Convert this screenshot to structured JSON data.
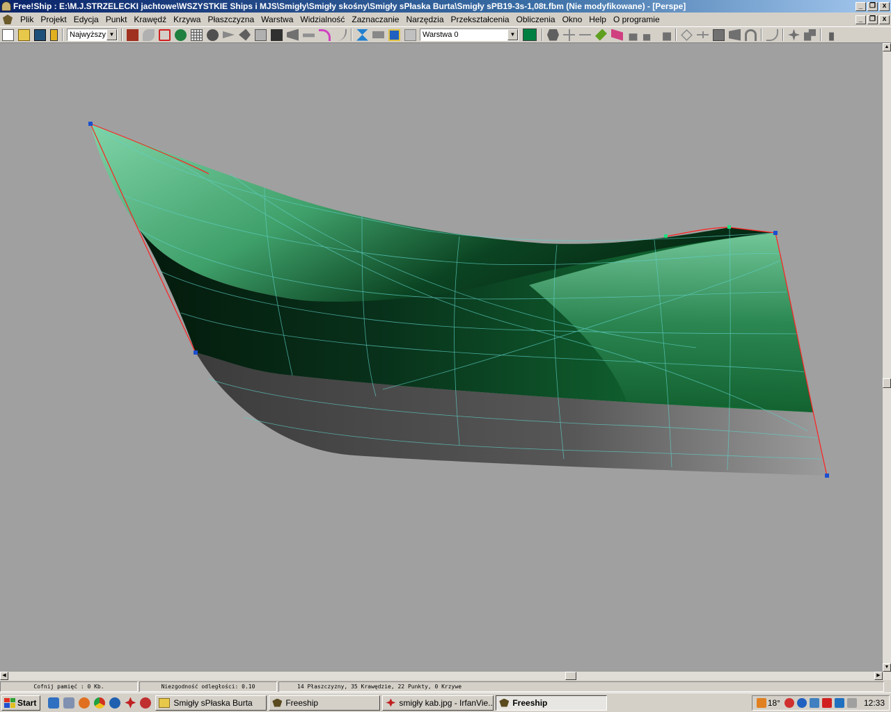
{
  "window": {
    "title": "Free!Ship  : E:\\M.J.STRZELECKI jachtowe\\WSZYSTKIE Ships i MJS\\Smigły\\Smigły skośny\\Smigły sPłaska Burta\\Smigły sPB19-3s-1,08t.fbm (Nie modyfikowane) - [Perspe]",
    "minimize_label": "_",
    "restore_label": "❐",
    "close_label": "x"
  },
  "menu": {
    "items": [
      "Plik",
      "Projekt",
      "Edycja",
      "Punkt",
      "Krawędź",
      "Krzywa",
      "Płaszczyzna",
      "Warstwa",
      "Widzialność",
      "Zaznaczanie",
      "Narzędzia",
      "Przekształcenia",
      "Obliczenia",
      "Okno",
      "Help",
      "O programie"
    ]
  },
  "toolbar": {
    "precision_value": "Najwyższy",
    "layer_value": "Warstwa 0",
    "layer_color": "#008040"
  },
  "viewport": {
    "background": "#a0a0a0",
    "hull_colors": {
      "light_green": "#6ec79a",
      "dark_green": "#0e4a26",
      "deep_green": "#062815",
      "bottom_grey": "#5a5a5a",
      "edge_red": "#ff2020",
      "grid_cyan": "#5fd0c8",
      "control_point": "#1a4fd0",
      "selected_point": "#20e080"
    }
  },
  "status": {
    "undo": "Cofnij pamięć : 0 Kb.",
    "distance": "Niezgodność odległości: 0.10",
    "counts": "14 Płaszczyzny, 35 Krawędzie, 22 Punkty, 0 Krzywe"
  },
  "taskbar": {
    "start_label": "Start",
    "tasks": [
      {
        "label": "Smigły sPłaska Burta",
        "active": false
      },
      {
        "label": "Freeship",
        "active": false
      },
      {
        "label": "smigły kab.jpg - IrfanVie...",
        "active": false
      },
      {
        "label": "Freeship",
        "active": true
      }
    ],
    "temperature": "18°",
    "clock": "12:33"
  }
}
